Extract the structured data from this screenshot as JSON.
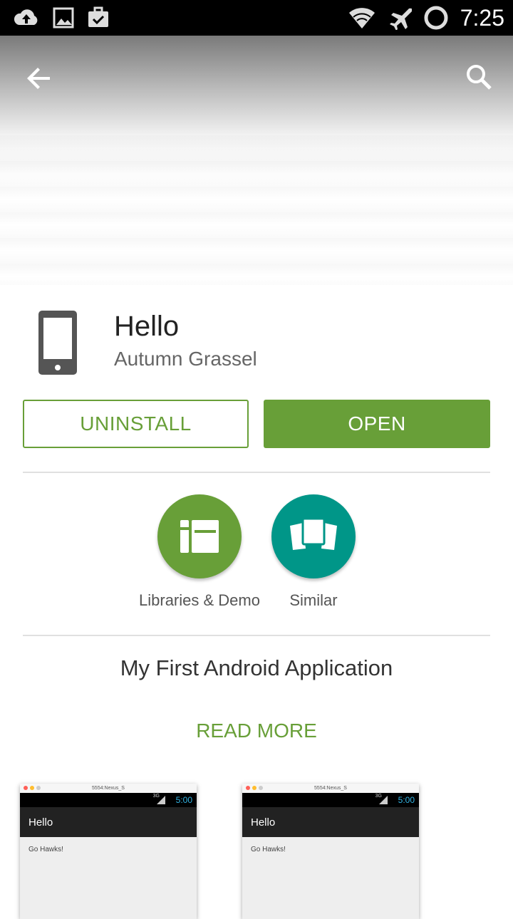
{
  "status_bar": {
    "time": "7:25",
    "icons_left": [
      "cloud-upload-icon",
      "image-icon",
      "briefcase-check-icon"
    ],
    "icons_right": [
      "wifi-icon",
      "airplane-icon",
      "sync-ring-icon"
    ]
  },
  "top_bar": {
    "back_icon": "arrow-back-icon",
    "search_icon": "search-icon"
  },
  "app": {
    "title": "Hello",
    "developer": "Autumn Grassel",
    "icon": "phone-icon"
  },
  "actions": {
    "uninstall_label": "UNINSTALL",
    "open_label": "OPEN"
  },
  "related": [
    {
      "label": "Libraries & Demo",
      "icon": "libraries-icon",
      "color": "#689f38"
    },
    {
      "label": "Similar",
      "icon": "cards-icon",
      "color": "#009688"
    }
  ],
  "description": "My First Android Application",
  "read_more_label": "READ MORE",
  "screenshots": [
    {
      "window_title": "5554:Nexus_S",
      "network": "3G",
      "clock": "5:00",
      "app_title": "Hello",
      "content_text": "Go Hawks!"
    },
    {
      "window_title": "5554:Nexus_S",
      "network": "3G",
      "clock": "5:00",
      "app_title": "Hello",
      "content_text": "Go Hawks!"
    }
  ],
  "colors": {
    "accent_green": "#689f38",
    "teal": "#009688"
  }
}
